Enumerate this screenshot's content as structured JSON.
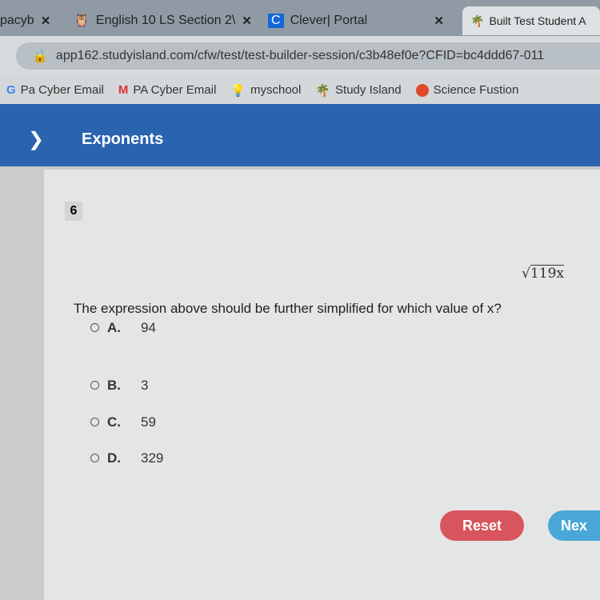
{
  "browser": {
    "tabs": [
      {
        "label": "pacyb"
      },
      {
        "label": "English 10 LS Section 2\\"
      },
      {
        "label": "Clever| Portal"
      },
      {
        "label": "Built Test Student A"
      }
    ],
    "url": "app162.studyisland.com/cfw/test/test-builder-session/c3b48ef0e?CFID=bc4ddd67-011",
    "bookmarks": [
      {
        "label": "Pa Cyber Email",
        "icon": "google-icon"
      },
      {
        "label": "PA Cyber Email",
        "icon": "gmail-icon"
      },
      {
        "label": "myschool",
        "icon": "lightbulb-icon"
      },
      {
        "label": "Study Island",
        "icon": "palm-tree-icon"
      },
      {
        "label": "Science Fustion",
        "icon": "red-circle-icon"
      }
    ]
  },
  "header": {
    "title": "Exponents"
  },
  "question": {
    "number": "6",
    "expression": "119x",
    "prompt": "The expression above should be further simplified for which value of x?",
    "options": [
      {
        "letter": "A.",
        "value": "94"
      },
      {
        "letter": "B.",
        "value": "3"
      },
      {
        "letter": "C.",
        "value": "59"
      },
      {
        "letter": "D.",
        "value": "329"
      }
    ]
  },
  "buttons": {
    "reset": "Reset",
    "next": "Nex"
  },
  "colors": {
    "header": "#2a64b0",
    "reset": "#d9555e",
    "next": "#4aa8d8"
  }
}
